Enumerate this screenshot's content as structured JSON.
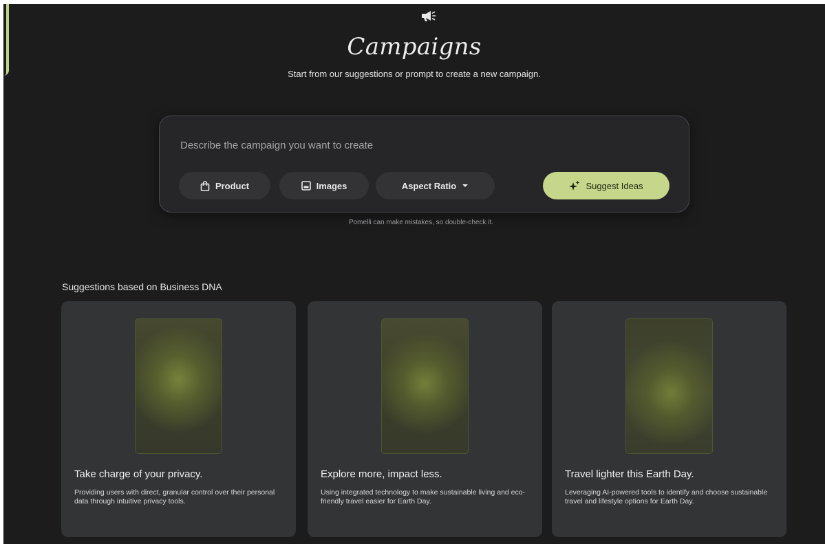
{
  "header": {
    "icon": "megaphone-icon",
    "title": "Campaigns",
    "subtitle": "Start from our suggestions or prompt to create a new campaign."
  },
  "prompt": {
    "placeholder": "Describe the campaign you want to create",
    "value": "",
    "chips": {
      "product": {
        "label": "Product",
        "icon": "shopping-bag-icon"
      },
      "images": {
        "label": "Images",
        "icon": "image-icon"
      },
      "aspect_ratio": {
        "label": "Aspect Ratio",
        "icon": "chevron-down-icon"
      }
    },
    "suggest_button": {
      "label": "Suggest Ideas",
      "icon": "sparkle-icon"
    },
    "disclaimer": "Pomelli can make mistakes, so double-check it."
  },
  "suggestions": {
    "heading": "Suggestions based on Business DNA",
    "cards": [
      {
        "title": "Take charge of your privacy.",
        "description": "Providing users with direct, granular control over their personal data through intuitive privacy tools."
      },
      {
        "title": "Explore more, impact less.",
        "description": "Using integrated technology to make sustainable living and eco-friendly travel easier for Earth Day."
      },
      {
        "title": "Travel lighter this Earth Day.",
        "description": "Leveraging AI-powered tools to identify and choose sustainable travel and lifestyle options for Earth Day."
      }
    ]
  },
  "colors": {
    "background": "#1c1c1d",
    "panel": "#262628",
    "card": "#333436",
    "accent": "#c6d68b"
  }
}
